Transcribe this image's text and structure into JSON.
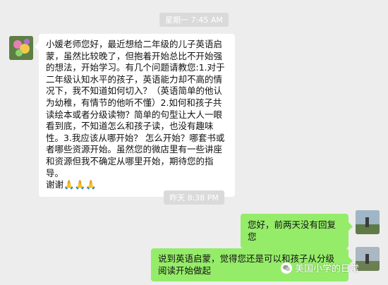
{
  "timestamps": [
    "星期一 7:45 AM",
    "昨天 8:38 PM"
  ],
  "messages": {
    "incoming": {
      "lines": [
        "小媛老师您好，最近想给二年级的儿子英语启蒙，虽然比较晚了，但抱着开始总比不开始强的想法，开始学习。有几个问题请教您:1.对于二年级认知水平的孩子，英语能力却不高的情况下，我不知道如何切入？（英语简单的他认为幼稚，有情节的他听不懂）2.如何和孩子共读绘本或者分级读物？简单的句型让大人一眼看到底，不知道怎么和孩子读，也没有趣味性。3.我应该从哪开始？ 怎么开始？哪套书或者哪些资源开始。虽然您的微店里有一些讲座和资源但我不确定从哪里开始，期待您的指导。",
        "谢谢"
      ],
      "emoji": "🙏🙏🙏"
    },
    "outgoing_1": "您好，前两天没有回复您",
    "outgoing_2": "说到英语启蒙，觉得您还是可以和孩子从分级阅读开始做起"
  },
  "watermark": "美国小学的日常",
  "colors": {
    "background": "#ededed",
    "outgoing_bubble": "#95ec69",
    "incoming_bubble": "#ffffff",
    "timestamp_bg": "#dadada"
  },
  "icons": [
    "avatar",
    "wechat-logo-icon"
  ]
}
